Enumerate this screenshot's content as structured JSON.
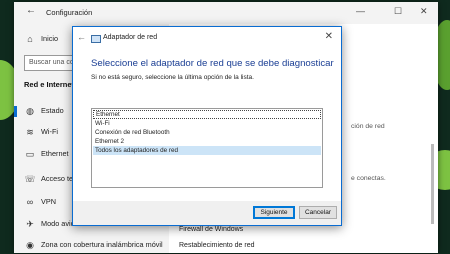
{
  "settings_window": {
    "title": "Configuración",
    "controls": [
      "—",
      "☐",
      "✕"
    ],
    "home_label": "Inicio",
    "search_placeholder": "Buscar una configu",
    "section_title": "Red e Internet",
    "nav_items": [
      {
        "icon": "globe-icon",
        "label": "Estado"
      },
      {
        "icon": "wifi-icon",
        "label": "Wi-Fi"
      },
      {
        "icon": "ethernet-icon",
        "label": "Ethernet"
      },
      {
        "icon": "phone-icon",
        "label": "Acceso tele"
      },
      {
        "icon": "vpn-icon",
        "label": "VPN"
      },
      {
        "icon": "airplane-icon",
        "label": "Modo avión"
      },
      {
        "icon": "hotspot-icon",
        "label": "Zona con cobertura inalámbrica móvil"
      }
    ],
    "main": {
      "partial_1": "ción de red",
      "partial_2": "e conectas.",
      "firewall_link": "Firewall de Windows",
      "reset_link": "Restablecimiento de red"
    }
  },
  "dialog": {
    "title": "Adaptador de red",
    "heading": "Seleccione el adaptador de red que se debe diagnosticar",
    "instruction": "Si no está seguro, seleccione la última opción de la lista.",
    "adapters": [
      "Ethernet",
      "Wi-Fi",
      "Conexión de red Bluetooth",
      "Ethernet 2",
      "Todos los adaptadores de red"
    ],
    "next_label": "Siguiente",
    "cancel_label": "Cancelar"
  },
  "colors": {
    "accent": "#0a6cd1",
    "heading_blue": "#1a3e94",
    "selected_item": "#cce4f7",
    "desktop_green": "#7dc242"
  }
}
